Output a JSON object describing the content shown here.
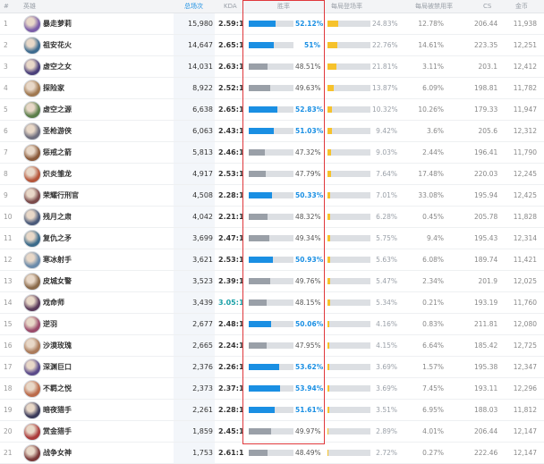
{
  "header": {
    "rank": "#",
    "hero": "英雄",
    "games": "总场次",
    "kda": "KDA",
    "winrate": "胜率",
    "pick_rate": "每局登场率",
    "ban_rate": "每局被禁用率",
    "cs": "CS",
    "gold": "金币"
  },
  "colors": {
    "accent_blue": "#1a8fe3",
    "bar_gray": "#9aa0a8",
    "bar_track": "#dcdfe3",
    "pick_yellow": "#f6c22c",
    "highlight_box": "#e0383c",
    "kda_teal": "#1ba1a8"
  },
  "rows": [
    {
      "rank": "1",
      "name": "暴走萝莉",
      "games": "15,980",
      "kda": "2.59:1",
      "kda_hi": false,
      "winrate": "52.12%",
      "win_value": 52.12,
      "win_hi": true,
      "pick": "24.83%",
      "pick_value": 24.83,
      "ban": "12.78%",
      "cs": "206.44",
      "gold": "11,938",
      "avatar": "#7b5ea8"
    },
    {
      "rank": "2",
      "name": "祖安花火",
      "games": "14,647",
      "kda": "2.65:1",
      "kda_hi": false,
      "winrate": "51%",
      "win_value": 51.0,
      "win_hi": true,
      "pick": "22.76%",
      "pick_value": 22.76,
      "ban": "14.61%",
      "cs": "223.35",
      "gold": "12,251",
      "avatar": "#3d6b8f"
    },
    {
      "rank": "3",
      "name": "虚空之女",
      "games": "14,031",
      "kda": "2.63:1",
      "kda_hi": false,
      "winrate": "48.51%",
      "win_value": 48.51,
      "win_hi": false,
      "pick": "21.81%",
      "pick_value": 21.81,
      "ban": "3.11%",
      "cs": "203.1",
      "gold": "12,412",
      "avatar": "#4a3f7a"
    },
    {
      "rank": "4",
      "name": "探险家",
      "games": "8,922",
      "kda": "2.52:1",
      "kda_hi": false,
      "winrate": "49.63%",
      "win_value": 49.63,
      "win_hi": false,
      "pick": "13.87%",
      "pick_value": 13.87,
      "ban": "6.09%",
      "cs": "198.81",
      "gold": "11,782",
      "avatar": "#a07850"
    },
    {
      "rank": "5",
      "name": "虚空之源",
      "games": "6,638",
      "kda": "2.65:1",
      "kda_hi": false,
      "winrate": "52.83%",
      "win_value": 52.83,
      "win_hi": true,
      "pick": "10.32%",
      "pick_value": 10.32,
      "ban": "10.26%",
      "cs": "179.33",
      "gold": "11,947",
      "avatar": "#5a7e4a"
    },
    {
      "rank": "6",
      "name": "圣枪游侠",
      "games": "6,063",
      "kda": "2.43:1",
      "kda_hi": false,
      "winrate": "51.03%",
      "win_value": 51.03,
      "win_hi": true,
      "pick": "9.42%",
      "pick_value": 9.42,
      "ban": "3.6%",
      "cs": "205.6",
      "gold": "12,312",
      "avatar": "#6e6e7e"
    },
    {
      "rank": "7",
      "name": "惩戒之箭",
      "games": "5,813",
      "kda": "2.46:1",
      "kda_hi": false,
      "winrate": "47.32%",
      "win_value": 47.32,
      "win_hi": false,
      "pick": "9.03%",
      "pick_value": 9.03,
      "ban": "2.44%",
      "cs": "196.41",
      "gold": "11,790",
      "avatar": "#8a5a3a"
    },
    {
      "rank": "8",
      "name": "炽炎雏龙",
      "games": "4,917",
      "kda": "2.53:1",
      "kda_hi": false,
      "winrate": "47.79%",
      "win_value": 47.79,
      "win_hi": false,
      "pick": "7.64%",
      "pick_value": 7.64,
      "ban": "17.48%",
      "cs": "220.03",
      "gold": "12,245",
      "avatar": "#b5563a"
    },
    {
      "rank": "9",
      "name": "荣耀行刑官",
      "games": "4,508",
      "kda": "2.28:1",
      "kda_hi": false,
      "winrate": "50.33%",
      "win_value": 50.33,
      "win_hi": true,
      "pick": "7.01%",
      "pick_value": 7.01,
      "ban": "33.08%",
      "cs": "195.94",
      "gold": "12,425",
      "avatar": "#7a4a4a"
    },
    {
      "rank": "10",
      "name": "残月之肃",
      "games": "4,042",
      "kda": "2.21:1",
      "kda_hi": false,
      "winrate": "48.32%",
      "win_value": 48.32,
      "win_hi": false,
      "pick": "6.28%",
      "pick_value": 6.28,
      "ban": "0.45%",
      "cs": "205.78",
      "gold": "11,828",
      "avatar": "#4a5a7a"
    },
    {
      "rank": "11",
      "name": "复仇之矛",
      "games": "3,699",
      "kda": "2.47:1",
      "kda_hi": false,
      "winrate": "49.34%",
      "win_value": 49.34,
      "win_hi": false,
      "pick": "5.75%",
      "pick_value": 5.75,
      "ban": "9.4%",
      "cs": "195.43",
      "gold": "12,314",
      "avatar": "#3a6a8a"
    },
    {
      "rank": "12",
      "name": "寒冰射手",
      "games": "3,621",
      "kda": "2.53:1",
      "kda_hi": false,
      "winrate": "50.93%",
      "win_value": 50.93,
      "win_hi": true,
      "pick": "5.63%",
      "pick_value": 5.63,
      "ban": "6.08%",
      "cs": "189.74",
      "gold": "11,421",
      "avatar": "#6a8aaa"
    },
    {
      "rank": "13",
      "name": "皮城女警",
      "games": "3,523",
      "kda": "2.39:1",
      "kda_hi": false,
      "winrate": "49.76%",
      "win_value": 49.76,
      "win_hi": false,
      "pick": "5.47%",
      "pick_value": 5.47,
      "ban": "2.34%",
      "cs": "201.9",
      "gold": "12,025",
      "avatar": "#8a6a4a"
    },
    {
      "rank": "14",
      "name": "戏命师",
      "games": "3,439",
      "kda": "3.05:1",
      "kda_hi": true,
      "winrate": "48.15%",
      "win_value": 48.15,
      "win_hi": false,
      "pick": "5.34%",
      "pick_value": 5.34,
      "ban": "0.21%",
      "cs": "193.19",
      "gold": "11,760",
      "avatar": "#5a3a5a"
    },
    {
      "rank": "15",
      "name": "逆羽",
      "games": "2,677",
      "kda": "2.48:1",
      "kda_hi": false,
      "winrate": "50.06%",
      "win_value": 50.06,
      "win_hi": true,
      "pick": "4.16%",
      "pick_value": 4.16,
      "ban": "0.83%",
      "cs": "211.81",
      "gold": "12,080",
      "avatar": "#9a4a6a"
    },
    {
      "rank": "16",
      "name": "沙漠玫瑰",
      "games": "2,665",
      "kda": "2.24:1",
      "kda_hi": false,
      "winrate": "47.95%",
      "win_value": 47.95,
      "win_hi": false,
      "pick": "4.15%",
      "pick_value": 4.15,
      "ban": "6.64%",
      "cs": "185.42",
      "gold": "12,725",
      "avatar": "#aa7a5a"
    },
    {
      "rank": "17",
      "name": "深渊巨口",
      "games": "2,376",
      "kda": "2.26:1",
      "kda_hi": false,
      "winrate": "53.62%",
      "win_value": 53.62,
      "win_hi": true,
      "pick": "3.69%",
      "pick_value": 3.69,
      "ban": "1.57%",
      "cs": "195.38",
      "gold": "12,347",
      "avatar": "#5a4a8a"
    },
    {
      "rank": "18",
      "name": "不羁之悦",
      "games": "2,373",
      "kda": "2.37:1",
      "kda_hi": false,
      "winrate": "53.94%",
      "win_value": 53.94,
      "win_hi": true,
      "pick": "3.69%",
      "pick_value": 3.69,
      "ban": "7.45%",
      "cs": "193.11",
      "gold": "12,296",
      "avatar": "#ba6a4a"
    },
    {
      "rank": "19",
      "name": "暗夜猎手",
      "games": "2,261",
      "kda": "2.28:1",
      "kda_hi": false,
      "winrate": "51.61%",
      "win_value": 51.61,
      "win_hi": true,
      "pick": "3.51%",
      "pick_value": 3.51,
      "ban": "6.95%",
      "cs": "188.03",
      "gold": "11,812",
      "avatar": "#3a3a5a"
    },
    {
      "rank": "20",
      "name": "赏金猎手",
      "games": "1,859",
      "kda": "2.45:1",
      "kda_hi": false,
      "winrate": "49.97%",
      "win_value": 49.97,
      "win_hi": false,
      "pick": "2.89%",
      "pick_value": 2.89,
      "ban": "4.01%",
      "cs": "206.44",
      "gold": "12,147",
      "avatar": "#aa3a3a"
    },
    {
      "rank": "21",
      "name": "战争女神",
      "games": "1,753",
      "kda": "2.61:1",
      "kda_hi": false,
      "winrate": "48.49%",
      "win_value": 48.49,
      "win_hi": false,
      "pick": "2.72%",
      "pick_value": 2.72,
      "ban": "0.27%",
      "cs": "222.46",
      "gold": "12,147",
      "avatar": "#7a3a3a"
    }
  ]
}
